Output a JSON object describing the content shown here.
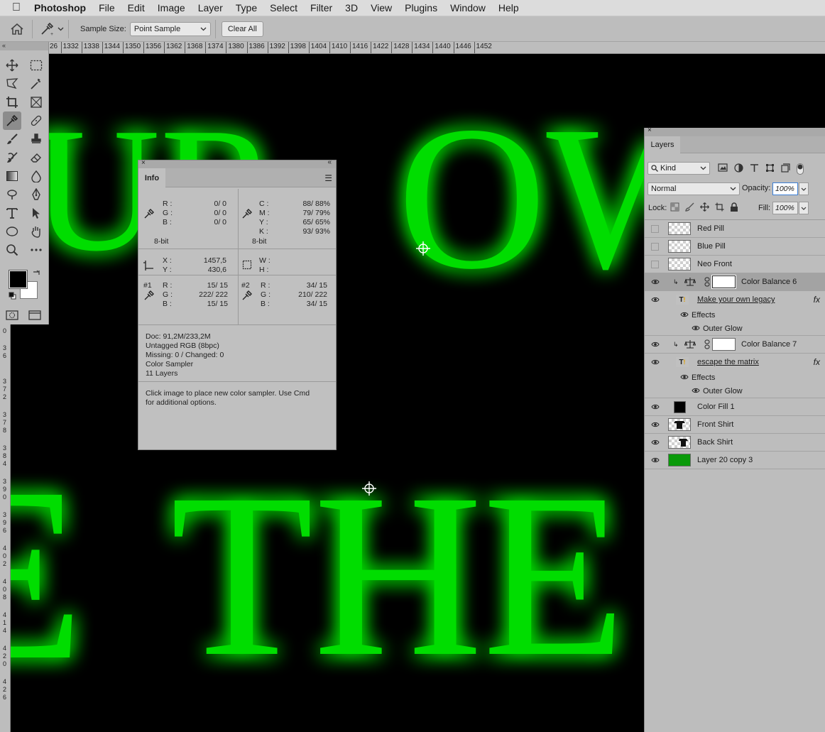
{
  "menubar": {
    "app": "Photoshop",
    "items": [
      "File",
      "Edit",
      "Image",
      "Layer",
      "Type",
      "Select",
      "Filter",
      "3D",
      "View",
      "Plugins",
      "Window",
      "Help"
    ]
  },
  "options": {
    "sample_size_label": "Sample Size:",
    "sample_size_value": "Point Sample",
    "clear_all": "Clear All"
  },
  "ruler": {
    "top_ticks": [
      "26",
      "1332",
      "1338",
      "1344",
      "1350",
      "1356",
      "1362",
      "1368",
      "1374",
      "1380",
      "1386",
      "1392",
      "1398",
      "1404",
      "1410",
      "1416",
      "1422",
      "1428",
      "1434",
      "1440",
      "1446",
      "1452"
    ],
    "left_ticks": [
      "0",
      "3 6",
      "3 7 2",
      "3 7 8",
      "3 8 4",
      "3 9 0",
      "3 9 6",
      "4 0 2",
      "4 0 8",
      "4 1 4",
      "4 2 0",
      "4 2 6"
    ]
  },
  "canvas": {
    "text_line1_left": "UR",
    "text_line1_right": "OWN",
    "text_line2_left": "E",
    "text_line2_right": "THE",
    "glow_color": "#00e600"
  },
  "info": {
    "title": "Info",
    "rgb": {
      "r_label": "R :",
      "g_label": "G :",
      "b_label": "B :",
      "r": "0/   0",
      "g": "0/   0",
      "b": "0/   0",
      "bit": "8-bit"
    },
    "cmyk": {
      "c_label": "C :",
      "m_label": "M :",
      "y_label": "Y :",
      "k_label": "K :",
      "c": "88/  88%",
      "m": "79/  79%",
      "y": "65/  65%",
      "k": "93/  93%",
      "bit": "8-bit"
    },
    "xy": {
      "x_label": "X :",
      "y_label": "Y :",
      "x": "1457,5",
      "y": "430,6"
    },
    "wh": {
      "w_label": "W :",
      "h_label": "H :"
    },
    "s1": {
      "id": "#1",
      "r_label": "R :",
      "g_label": "G :",
      "b_label": "B :",
      "r": "15/   15",
      "g": "222/  222",
      "b": "15/   15"
    },
    "s2": {
      "id": "#2",
      "r_label": "R :",
      "g_label": "G :",
      "b_label": "B :",
      "r": "34/   15",
      "g": "210/  222",
      "b": "34/   15"
    },
    "doc": [
      "Doc: 91,2M/233,2M",
      "Untagged RGB (8bpc)",
      "Missing: 0 / Changed: 0",
      "Color Sampler",
      "11 Layers"
    ],
    "hint": [
      "Click image to place new color sampler.  Use Cmd",
      "for additional options."
    ]
  },
  "layers": {
    "title": "Layers",
    "filter_value": "Kind",
    "blend_mode": "Normal",
    "opacity_label": "Opacity:",
    "opacity": "100%",
    "lock_label": "Lock:",
    "fill_label": "Fill:",
    "fill": "100%",
    "rows": [
      {
        "name": "Red Pill"
      },
      {
        "name": "Blue Pill"
      },
      {
        "name": "Neo Front"
      },
      {
        "name": "Color Balance 6"
      },
      {
        "name": "Make your own legacy",
        "fx": "fx"
      },
      {
        "name": "Effects"
      },
      {
        "name": "Outer Glow"
      },
      {
        "name": "Color Balance 7"
      },
      {
        "name": "escape the matrix",
        "fx": "fx"
      },
      {
        "name": "Effects"
      },
      {
        "name": "Outer Glow"
      },
      {
        "name": "Color Fill 1"
      },
      {
        "name": "Front Shirt"
      },
      {
        "name": "Back Shirt"
      },
      {
        "name": "Layer 20 copy 3"
      }
    ]
  }
}
